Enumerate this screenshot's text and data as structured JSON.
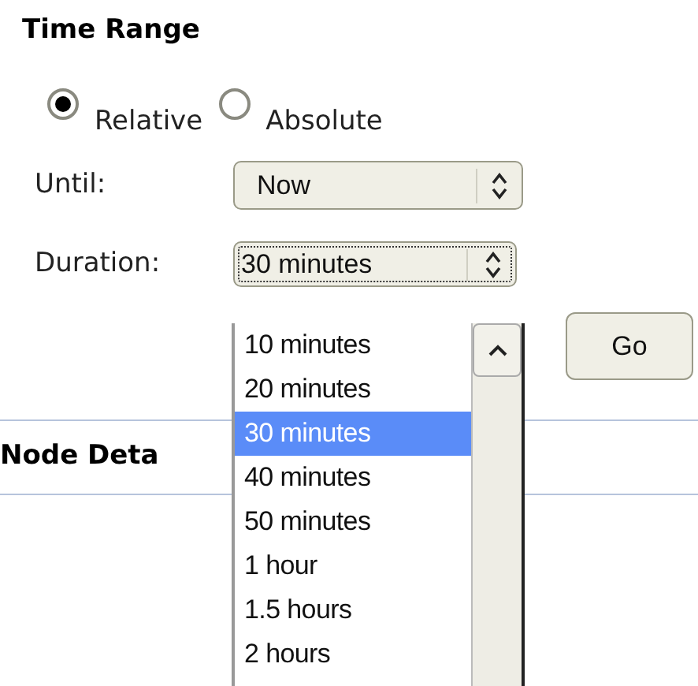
{
  "section_title": "Time Range",
  "mode": [
    {
      "label": "Relative",
      "selected": true
    },
    {
      "label": "Absolute",
      "selected": false
    }
  ],
  "until": {
    "label": "Until:",
    "value": "Now"
  },
  "duration": {
    "label": "Duration:",
    "value": "30 minutes",
    "expanded": true,
    "options": [
      {
        "label": "10 minutes",
        "selected": false
      },
      {
        "label": "20 minutes",
        "selected": false
      },
      {
        "label": "30 minutes",
        "selected": true
      },
      {
        "label": "40 minutes",
        "selected": false
      },
      {
        "label": "50 minutes",
        "selected": false
      },
      {
        "label": "1 hour",
        "selected": false
      },
      {
        "label": "1.5 hours",
        "selected": false
      },
      {
        "label": "2 hours",
        "selected": false
      }
    ]
  },
  "go_button": "Go",
  "next_section_title": "Node Deta"
}
